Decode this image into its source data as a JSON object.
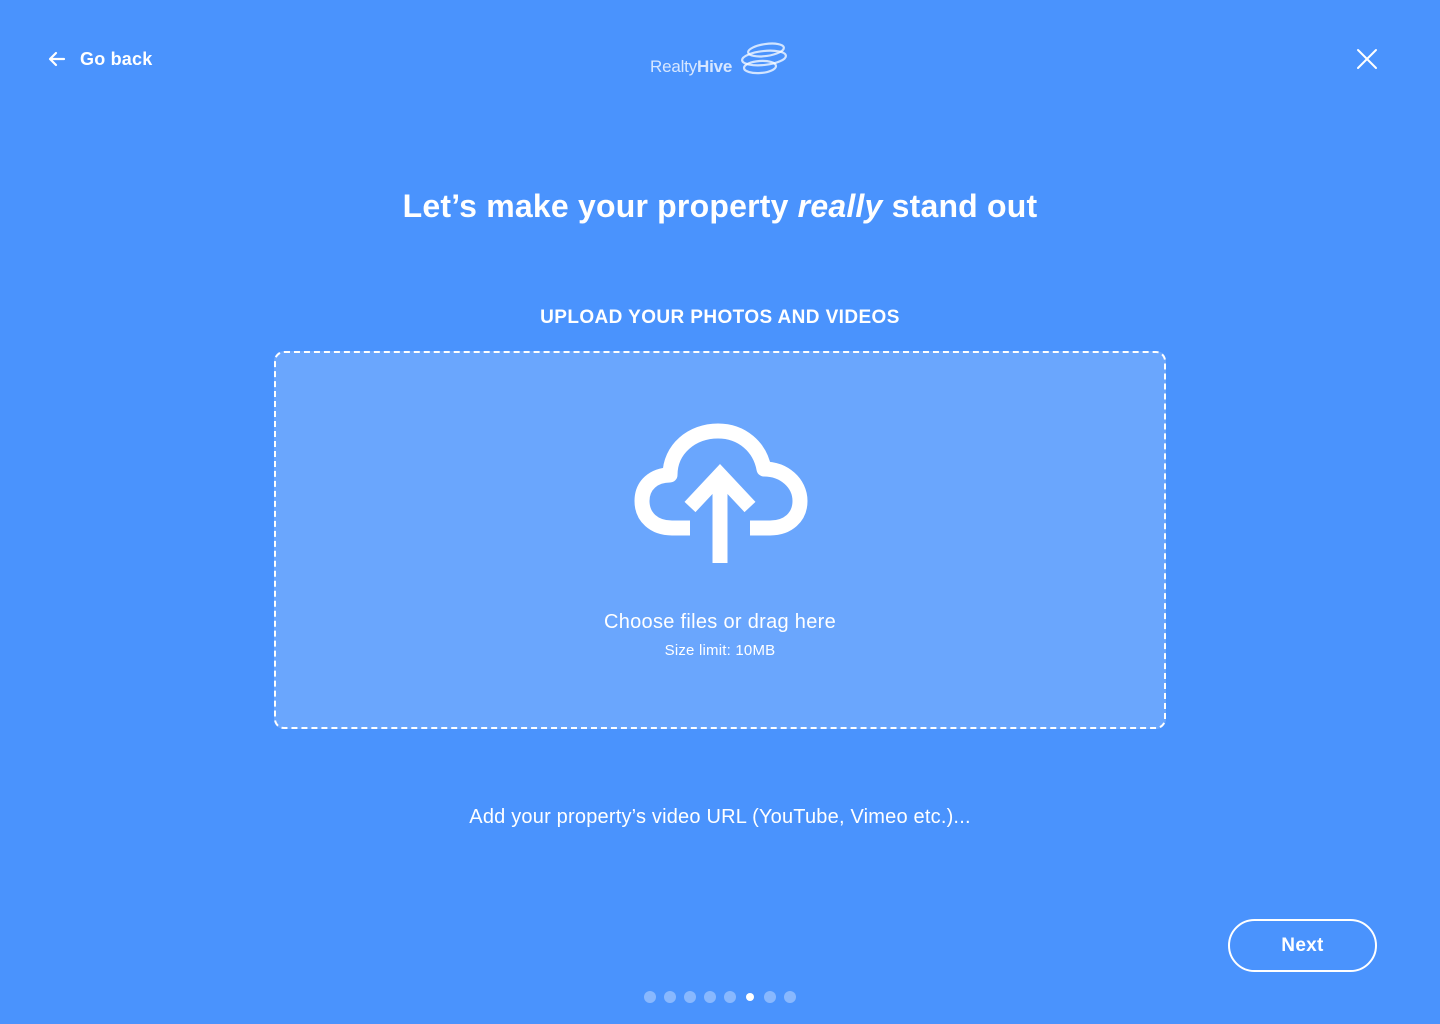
{
  "header": {
    "back_label": "Go back",
    "back_icon": "arrow-left-icon",
    "logo": {
      "text_light": "Realty",
      "text_bold": "Hive"
    },
    "close_icon": "close-icon"
  },
  "headline": {
    "before": "Let’s make your property ",
    "emphasis": "really",
    "after": " stand out"
  },
  "upload": {
    "section_label": "UPLOAD YOUR PHOTOS AND VIDEOS",
    "icon": "cloud-upload-icon",
    "primary_text": "Choose files or drag here",
    "secondary_text": "Size limit: 10MB"
  },
  "video_url": {
    "placeholder": "Add your property’s video URL (YouTube, Vimeo etc.)...",
    "value": ""
  },
  "footer": {
    "next_label": "Next"
  },
  "progress": {
    "total_steps": 8,
    "current_step": 6
  },
  "colors": {
    "background": "#4a93fd",
    "foreground": "#ffffff",
    "dropzone_fill": "#6ba8fd"
  }
}
